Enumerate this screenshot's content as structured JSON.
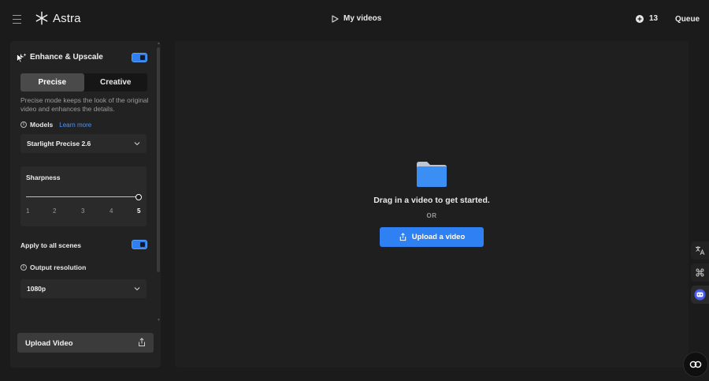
{
  "app": {
    "brand": "Astra"
  },
  "header": {
    "nav_label": "My videos",
    "credits": "13",
    "queue_label": "Queue"
  },
  "panel": {
    "title": "Enhance & Upscale",
    "enhance_enabled": true,
    "modes": [
      "Precise",
      "Creative"
    ],
    "active_mode": "Precise",
    "description": "Precise mode keeps the look of the original video and enhances the details.",
    "models_label": "Models",
    "learn_more": "Learn more",
    "model_value": "Starlight Precise 2.6",
    "sharpness_label": "Sharpness",
    "sharpness_ticks": [
      "1",
      "2",
      "3",
      "4",
      "5"
    ],
    "sharpness_value": 5,
    "apply_label": "Apply to all scenes",
    "apply_enabled": true,
    "output_label": "Output resolution",
    "output_value": "1080p",
    "upload_label": "Upload Video"
  },
  "main": {
    "drag_text": "Drag in a video to get started.",
    "or_text": "OR",
    "upload_label": "Upload a video"
  },
  "colors": {
    "accent": "#2f80f2",
    "panel": "#222222",
    "bg": "#1b1b1b"
  },
  "icons": [
    "menu-icon",
    "astra-logo-icon",
    "play-icon",
    "plus-circle-icon",
    "sparkle-icon",
    "info-icon",
    "chevron-down-icon",
    "share-upload-icon",
    "folder-icon",
    "translate-icon",
    "command-icon",
    "bot-icon",
    "cc-icon",
    "cursor-icon"
  ]
}
